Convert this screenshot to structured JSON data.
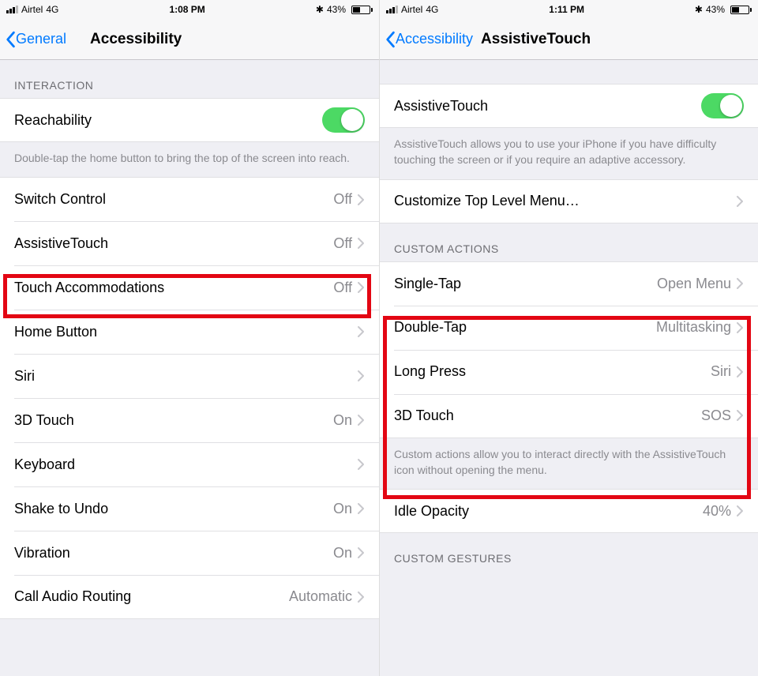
{
  "left": {
    "status": {
      "carrier": "Airtel",
      "net": "4G",
      "time": "1:08 PM",
      "battery": "43%"
    },
    "nav": {
      "back": "General",
      "title": "Accessibility"
    },
    "section_interaction": "INTERACTION",
    "reachability": "Reachability",
    "reachability_footer": "Double-tap the home button to bring the top of the screen into reach.",
    "rows": {
      "switch_control": {
        "label": "Switch Control",
        "value": "Off"
      },
      "assistivetouch": {
        "label": "AssistiveTouch",
        "value": "Off"
      },
      "touch_accom": {
        "label": "Touch Accommodations",
        "value": "Off"
      },
      "home_button": {
        "label": "Home Button",
        "value": ""
      },
      "siri": {
        "label": "Siri",
        "value": ""
      },
      "three_d_touch": {
        "label": "3D Touch",
        "value": "On"
      },
      "keyboard": {
        "label": "Keyboard",
        "value": ""
      },
      "shake_undo": {
        "label": "Shake to Undo",
        "value": "On"
      },
      "vibration": {
        "label": "Vibration",
        "value": "On"
      },
      "call_audio": {
        "label": "Call Audio Routing",
        "value": "Automatic"
      }
    }
  },
  "right": {
    "status": {
      "carrier": "Airtel",
      "net": "4G",
      "time": "1:11 PM",
      "battery": "43%"
    },
    "nav": {
      "back": "Accessibility",
      "title": "AssistiveTouch"
    },
    "toggle_row": "AssistiveTouch",
    "toggle_footer": "AssistiveTouch allows you to use your iPhone if you have difficulty touching the screen or if you require an adaptive accessory.",
    "customize_menu": "Customize Top Level Menu…",
    "section_custom_actions": "CUSTOM ACTIONS",
    "actions": {
      "single_tap": {
        "label": "Single-Tap",
        "value": "Open Menu"
      },
      "double_tap": {
        "label": "Double-Tap",
        "value": "Multitasking"
      },
      "long_press": {
        "label": "Long Press",
        "value": "Siri"
      },
      "three_d_touch": {
        "label": "3D Touch",
        "value": "SOS"
      }
    },
    "actions_footer": "Custom actions allow you to interact directly with the AssistiveTouch icon without opening the menu.",
    "idle_opacity": {
      "label": "Idle Opacity",
      "value": "40%"
    },
    "section_custom_gestures": "CUSTOM GESTURES"
  }
}
